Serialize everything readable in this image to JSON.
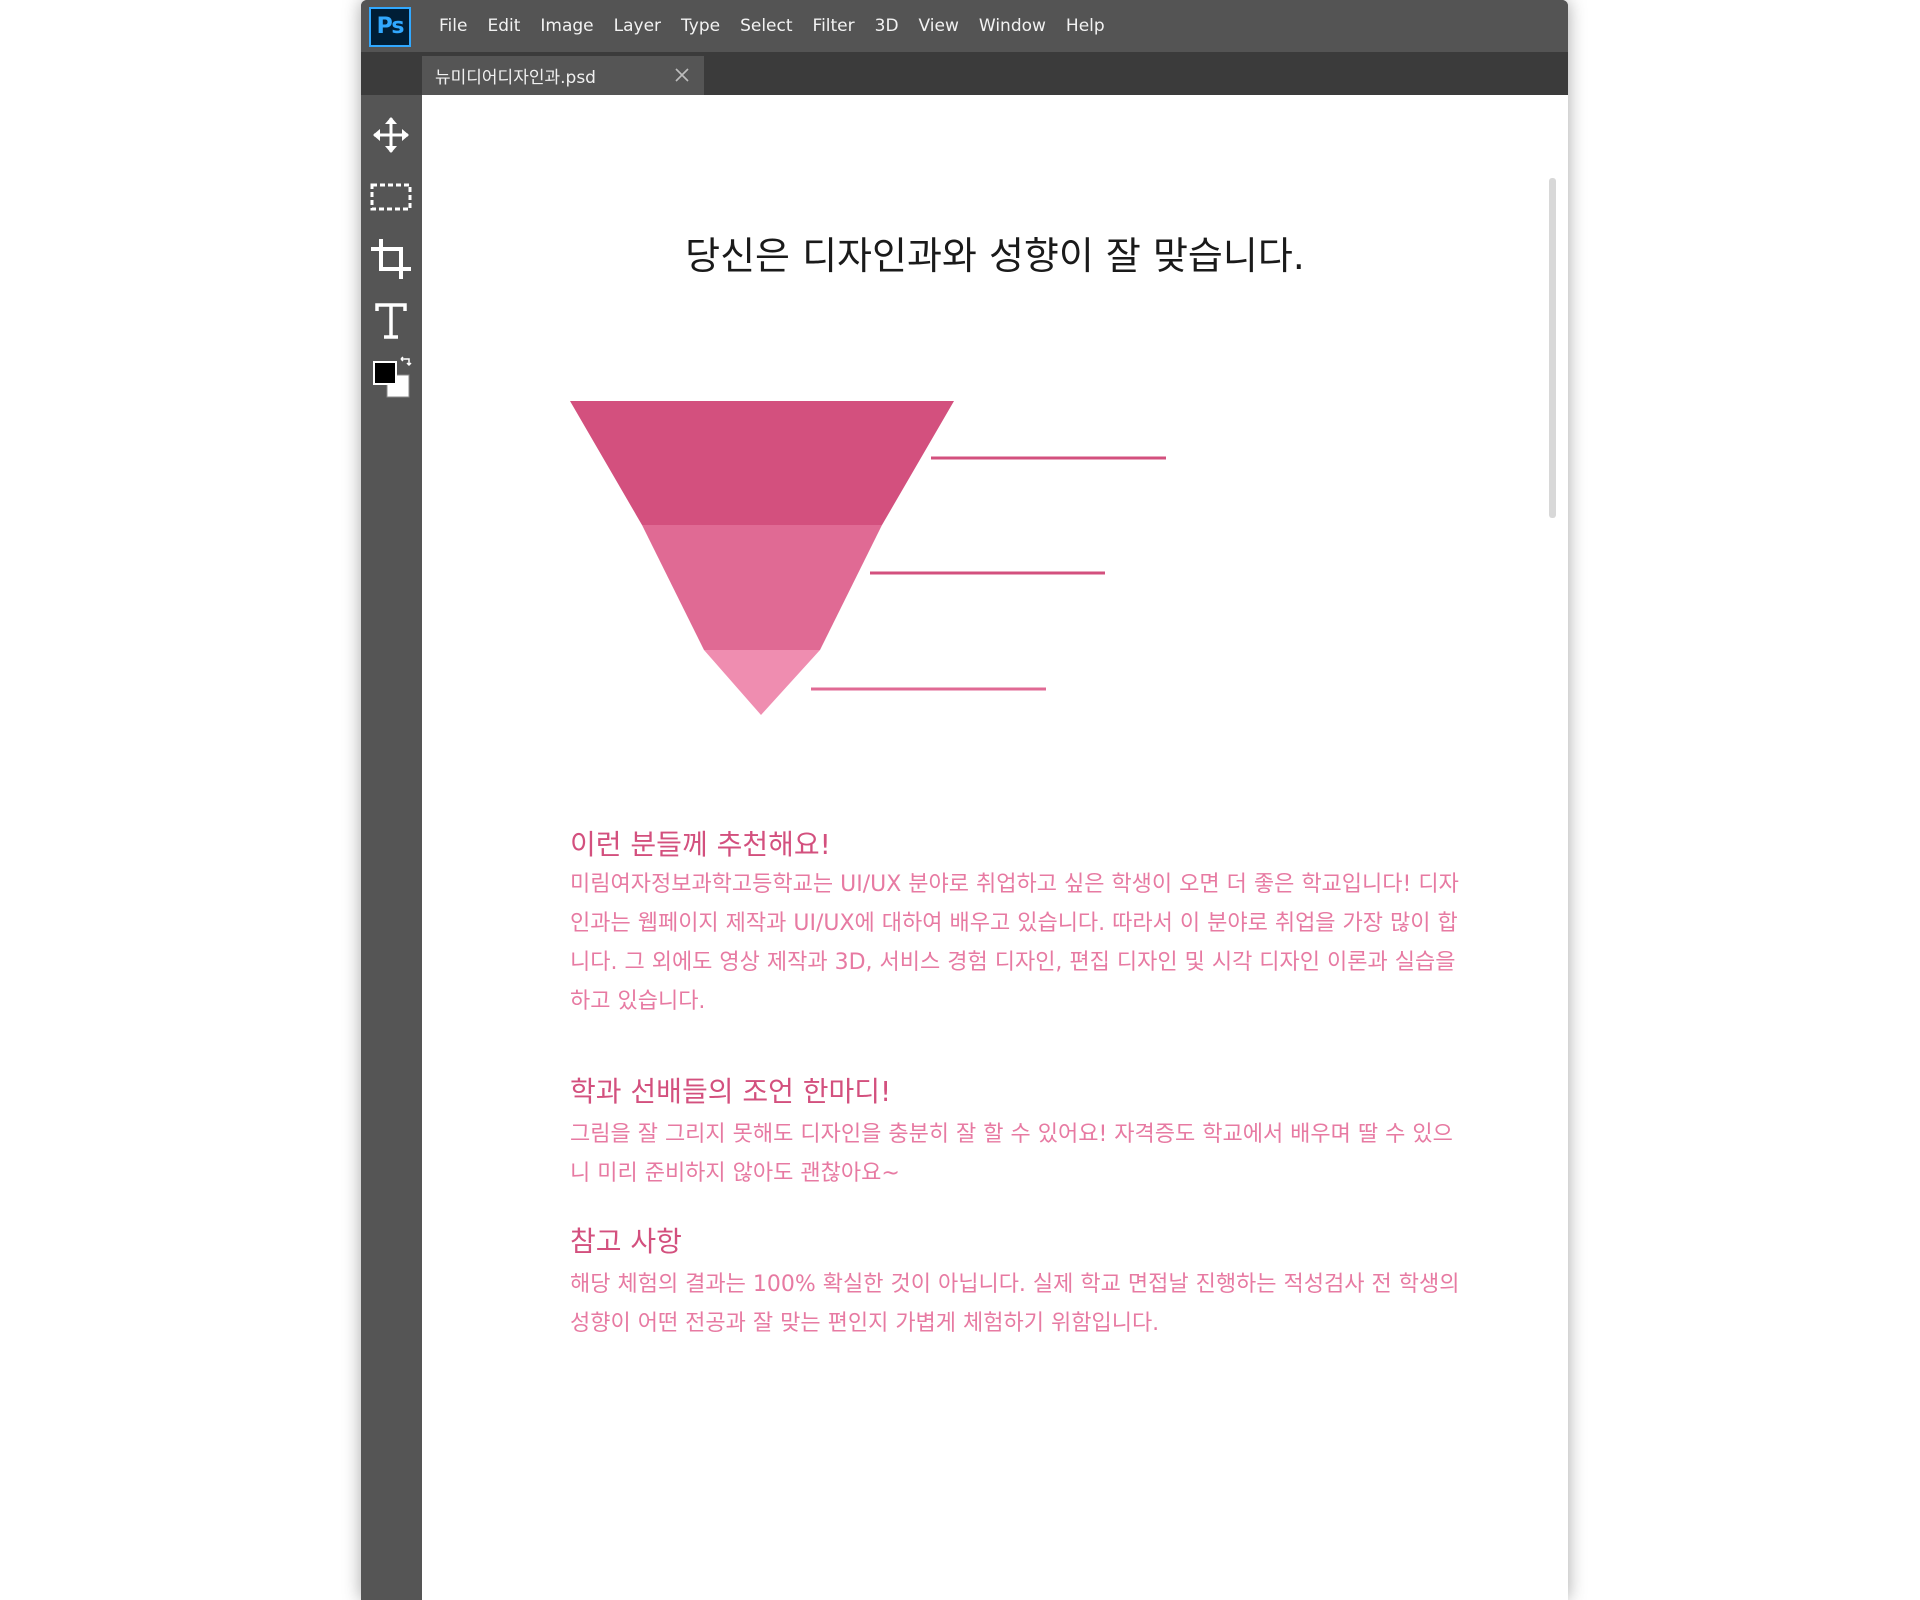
{
  "app": {
    "logo_text": "Ps",
    "menu": [
      "File",
      "Edit",
      "Image",
      "Layer",
      "Type",
      "Select",
      "Filter",
      "3D",
      "View",
      "Window",
      "Help"
    ],
    "tab": {
      "title": "뉴미디어디자인과.psd"
    },
    "tools": [
      "move-tool-icon",
      "marquee-tool-icon",
      "crop-tool-icon",
      "type-tool-icon",
      "color-swatch-icon"
    ],
    "colors": {
      "chrome": "#555555",
      "tabbar": "#3b3b3b",
      "accent": "#31a8ff",
      "pink_dark": "#d3507e",
      "pink_mid": "#e06a94",
      "pink_light": "#ef8db0"
    }
  },
  "document": {
    "heading": "당신은 디자인과와 성향이 잘 맞습니다.",
    "sections": [
      {
        "title": "이런 분들께 추천해요!",
        "body": "미림여자정보과학고등학교는 UI/UX 분야로 취업하고 싶은 학생이 오면 더 좋은 학교입니다! 디자인과는 웹페이지 제작과 UI/UX에 대하여 배우고 있습니다. 따라서 이 분야로 취업을 가장 많이 합니다.  그 외에도 영상 제작과 3D, 서비스 경험 디자인, 편집 디자인 및 시각 디자인 이론과 실습을 하고 있습니다."
      },
      {
        "title": "학과 선배들의 조언 한마디!",
        "body": "그림을 잘 그리지 못해도 디자인을 충분히 잘 할 수 있어요! 자격증도 학교에서 배우며 딸 수 있으니 미리 준비하지 않아도 괜찮아요~"
      },
      {
        "title": "참고 사항",
        "body": "해당 체험의 결과는 100% 확실한 것이 아닙니다. 실제 학교 면접날 진행하는 적성검사 전 학생의 성향이 어떤 전공과 잘 맞는 편인지 가볍게 체험하기 위함입니다."
      }
    ]
  }
}
